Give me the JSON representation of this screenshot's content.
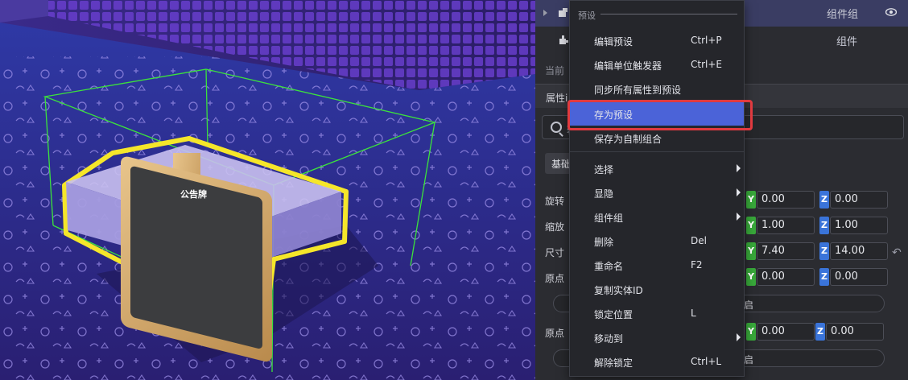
{
  "viewport": {
    "sign_text": "公告牌",
    "colors": {
      "selection_outline": "#f5e62a",
      "bounds_box": "#3ce23c",
      "floor": "#2a237a"
    }
  },
  "inspector": {
    "tree": [
      {
        "label": "组件组",
        "selected": true,
        "icon": "group-node-icon"
      },
      {
        "label": "组件",
        "selected": false,
        "icon": "component-node-icon"
      }
    ],
    "current_label": "当前",
    "section_title": "属性i",
    "search_placeholder": "输",
    "tab_basic": "基础",
    "rows": [
      {
        "label": "旋转",
        "y": "0.00",
        "z": "0.00"
      },
      {
        "label": "缩放",
        "y": "1.00",
        "z": "1.00"
      },
      {
        "label": "尺寸",
        "y": "7.40",
        "z": "14.00"
      },
      {
        "label": "原点",
        "y": "0.00",
        "z": "0.00"
      },
      {
        "label": "原点",
        "y": "0.00",
        "z": "0.00"
      }
    ],
    "pill_text": "启",
    "axis_y": "Y",
    "axis_z": "Z"
  },
  "menu": {
    "title": "预设",
    "items": [
      {
        "label": "编辑预设",
        "shortcut": "Ctrl+P",
        "submenu": false,
        "highlighted": false
      },
      {
        "label": "编辑单位触发器",
        "shortcut": "Ctrl+E",
        "submenu": false,
        "highlighted": false
      },
      {
        "label": "同步所有属性到预设",
        "shortcut": "",
        "submenu": false,
        "highlighted": false
      },
      {
        "label": "存为预设",
        "shortcut": "",
        "submenu": false,
        "highlighted": true
      },
      {
        "label": "保存为自制组合",
        "shortcut": "",
        "submenu": false,
        "highlighted": false
      },
      {
        "label": "选择",
        "shortcut": "",
        "submenu": true,
        "highlighted": false
      },
      {
        "label": "显隐",
        "shortcut": "",
        "submenu": true,
        "highlighted": false
      },
      {
        "label": "组件组",
        "shortcut": "",
        "submenu": true,
        "highlighted": false
      },
      {
        "label": "删除",
        "shortcut": "Del",
        "submenu": false,
        "highlighted": false
      },
      {
        "label": "重命名",
        "shortcut": "F2",
        "submenu": false,
        "highlighted": false
      },
      {
        "label": "复制实体ID",
        "shortcut": "",
        "submenu": false,
        "highlighted": false
      },
      {
        "label": "锁定位置",
        "shortcut": "L",
        "submenu": false,
        "highlighted": false
      },
      {
        "label": "移动到",
        "shortcut": "",
        "submenu": true,
        "highlighted": false
      },
      {
        "label": "解除锁定",
        "shortcut": "Ctrl+L",
        "submenu": false,
        "highlighted": false
      }
    ],
    "colors": {
      "highlight": "#4b63d8",
      "frame": "#e03a3f"
    }
  }
}
